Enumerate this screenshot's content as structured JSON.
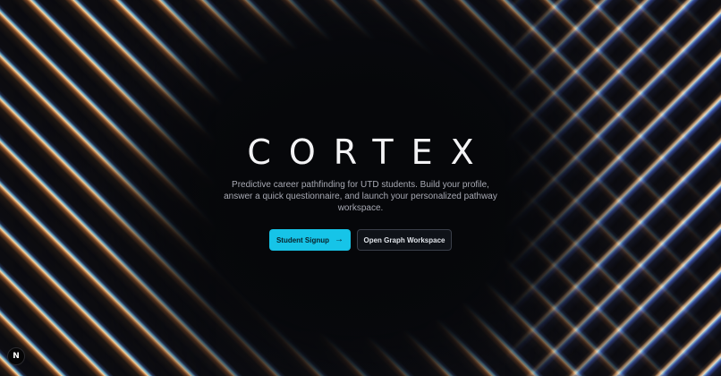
{
  "hero": {
    "title": "CORTEX",
    "tagline": "Predictive career pathfinding for UTD students. Build your profile, answer a quick questionnaire, and launch your personalized pathway workspace."
  },
  "actions": {
    "primary_label": "Student Signup",
    "primary_icon": "arrow-right-icon",
    "secondary_label": "Open Graph Workspace"
  },
  "badge": {
    "letter": "N",
    "icon": "nextjs-logo-icon"
  },
  "colors": {
    "accent": "#16c4e8",
    "background": "#0a0b10",
    "title": "#f3f3f5",
    "tagline": "#a7a9b3"
  }
}
